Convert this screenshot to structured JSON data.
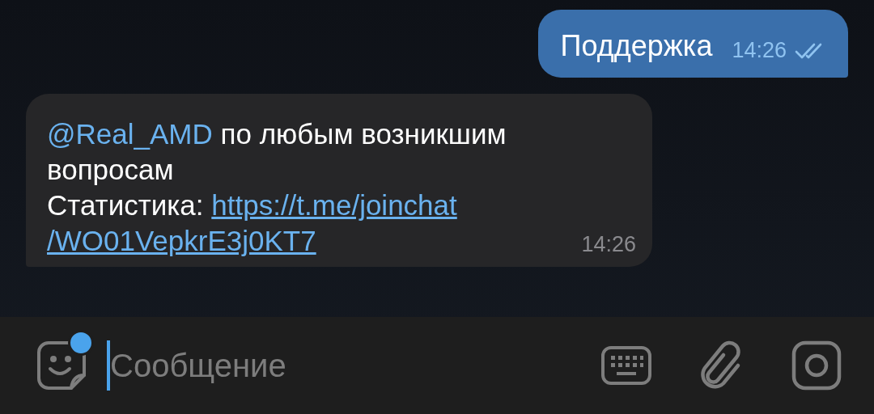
{
  "messages": [
    {
      "kind": "outgoing",
      "text": "Поддержка",
      "time": "14:26",
      "read": true
    },
    {
      "kind": "incoming",
      "mention": "@Real_AMD",
      "text": " по любым возникшим вопросам",
      "label": "Статистика: ",
      "link_lines": [
        "https://t.me/joinchat",
        "/WO01VepkrE3j0KT7"
      ],
      "time": "14:26"
    }
  ],
  "composer": {
    "placeholder": "Сообщение",
    "sticker_badge": true
  }
}
